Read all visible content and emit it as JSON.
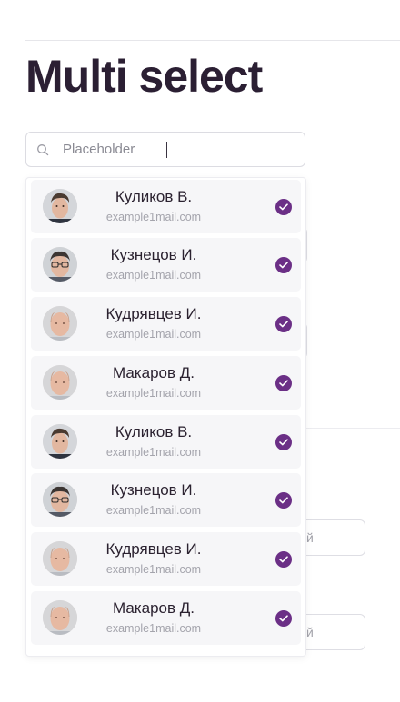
{
  "page": {
    "title": "Multi select"
  },
  "search": {
    "placeholder": "Placeholder",
    "value": ""
  },
  "background_fields": [
    {
      "suffix": "й"
    },
    {
      "suffix": "й"
    }
  ],
  "options": [
    {
      "name": "Куликов В.",
      "email": "example1mail.com",
      "selected": true,
      "avatar": "avatar-young-man"
    },
    {
      "name": "Кузнецов И.",
      "email": "example1mail.com",
      "selected": true,
      "avatar": "avatar-man-glasses"
    },
    {
      "name": "Кудрявцев И.",
      "email": "example1mail.com",
      "selected": true,
      "avatar": "avatar-bald-man"
    },
    {
      "name": "Макаров Д.",
      "email": "example1mail.com",
      "selected": true,
      "avatar": "avatar-bald-man"
    },
    {
      "name": "Куликов В.",
      "email": "example1mail.com",
      "selected": true,
      "avatar": "avatar-young-man"
    },
    {
      "name": "Кузнецов И.",
      "email": "example1mail.com",
      "selected": true,
      "avatar": "avatar-man-glasses"
    },
    {
      "name": "Кудрявцев И.",
      "email": "example1mail.com",
      "selected": true,
      "avatar": "avatar-bald-man"
    },
    {
      "name": "Макаров Д.",
      "email": "example1mail.com",
      "selected": true,
      "avatar": "avatar-bald-man"
    }
  ],
  "colors": {
    "accent": "#6b2f86",
    "title": "#2b1f33",
    "option_bg": "#f6f6f8"
  },
  "icons": {
    "search": "search-icon",
    "check": "check-circle-icon"
  }
}
